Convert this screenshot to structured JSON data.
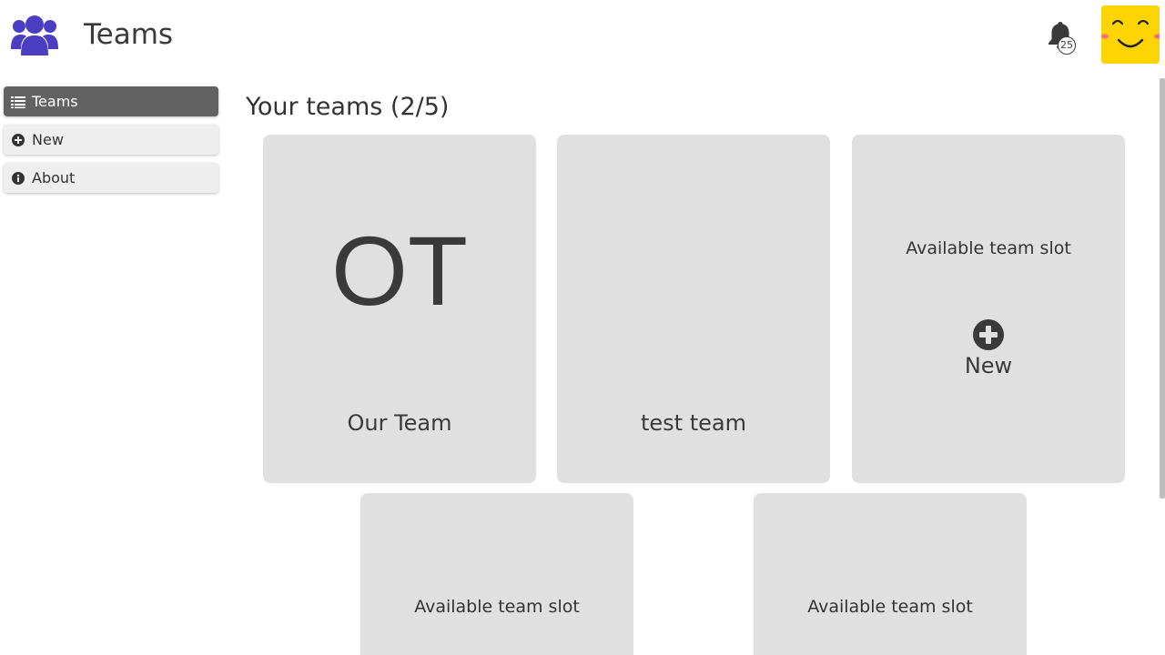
{
  "header": {
    "title": "Teams",
    "logo_icon": "users-icon",
    "notification_icon": "bell-icon",
    "notification_count": "25",
    "avatar_icon": "smiley-avatar",
    "accent_color": "#4b3ec2",
    "avatar_color": "#ffd400"
  },
  "sidebar": {
    "items": [
      {
        "label": "Teams",
        "icon": "list-icon",
        "active": true
      },
      {
        "label": "New",
        "icon": "plus-circle-icon",
        "active": false
      },
      {
        "label": "About",
        "icon": "info-icon",
        "active": false
      }
    ]
  },
  "main": {
    "heading": "Your teams (2/5)",
    "teams": [
      {
        "initials": "OT",
        "name": "Our Team"
      },
      {
        "initials": "",
        "name": "test team"
      }
    ],
    "slots": [
      {
        "label": "Available team slot",
        "new_label": "New",
        "new_icon": "plus-circle-icon"
      },
      {
        "label": "Available team slot"
      },
      {
        "label": "Available team slot"
      }
    ]
  }
}
